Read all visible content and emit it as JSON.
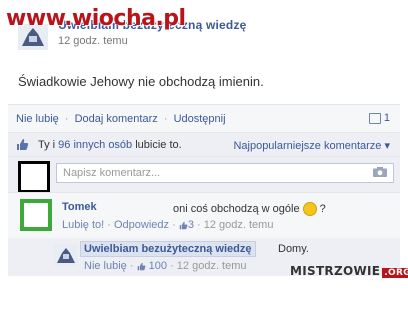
{
  "watermark_top": "www.wiocha.pl",
  "page": {
    "name": "Uwielbiam bezużyteczną wiedzę",
    "timestamp": "12 godz. temu"
  },
  "post": {
    "text": "Świadkowie Jehowy nie obchodzą imienin."
  },
  "actions": {
    "unlike": "Nie lubię",
    "add_comment": "Dodaj komentarz",
    "share": "Udostępnij",
    "separator": "·",
    "comment_count": "1"
  },
  "likes": {
    "text_prefix": "Ty i ",
    "others_link": "96 innych osób",
    "text_suffix": " lubicie to.",
    "sort_label": "Najpopularniejsze komentarze ▾"
  },
  "composer": {
    "placeholder": "Napisz komentarz..."
  },
  "comment": {
    "author": "Tomek",
    "text": "oni coś obchodzą w ogóle",
    "text_after": "?",
    "like": "Lubię to!",
    "reply": "Odpowiedz",
    "likes": "3",
    "time": "12 godz. temu",
    "sep": " · "
  },
  "reply": {
    "author": "Uwielbiam bezużyteczną wiedzę",
    "text": "Domy.",
    "unlike": "Nie lubię",
    "likes": "100",
    "time": "12 godz. temu",
    "sep": " · "
  },
  "watermark_bottom": {
    "name": "MISTRZOWIE",
    "tld": ".ORG"
  },
  "colors": {
    "link": "#3b5998",
    "watermark_red": "#b8141a",
    "green_border": "#3fa83a"
  }
}
